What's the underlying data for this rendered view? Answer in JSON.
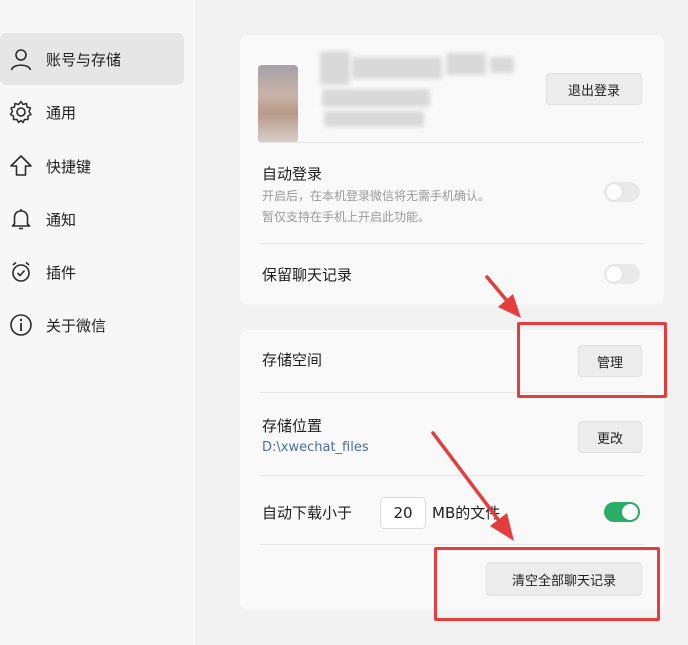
{
  "sidebar": {
    "items": [
      {
        "label": "账号与存储",
        "icon": "user-icon",
        "active": true
      },
      {
        "label": "通用",
        "icon": "gear-icon",
        "active": false
      },
      {
        "label": "快捷键",
        "icon": "keyboard-arrow-icon",
        "active": false
      },
      {
        "label": "通知",
        "icon": "bell-icon",
        "active": false
      },
      {
        "label": "插件",
        "icon": "plugin-icon",
        "active": false
      },
      {
        "label": "关于微信",
        "icon": "info-icon",
        "active": false
      }
    ]
  },
  "account": {
    "logout_label": "退出登录"
  },
  "auto_login": {
    "title": "自动登录",
    "desc_line1": "开启后，在本机登录微信将无需手机确认。",
    "desc_line2": "暂仅支持在手机上开启此功能。",
    "enabled": false
  },
  "keep_chat": {
    "title": "保留聊天记录",
    "enabled": false
  },
  "storage": {
    "space_title": "存储空间",
    "manage_label": "管理",
    "location_title": "存储位置",
    "location_path": "D:\\xwechat_files",
    "change_label": "更改",
    "auto_download_prefix": "自动下载小于",
    "auto_download_value": "20",
    "auto_download_suffix": "MB的文件",
    "auto_download_enabled": true,
    "clear_label": "清空全部聊天记录"
  },
  "colors": {
    "highlight": "#e43d3d",
    "toggle_on": "#2aae67",
    "path_link": "#4b6f9c"
  }
}
